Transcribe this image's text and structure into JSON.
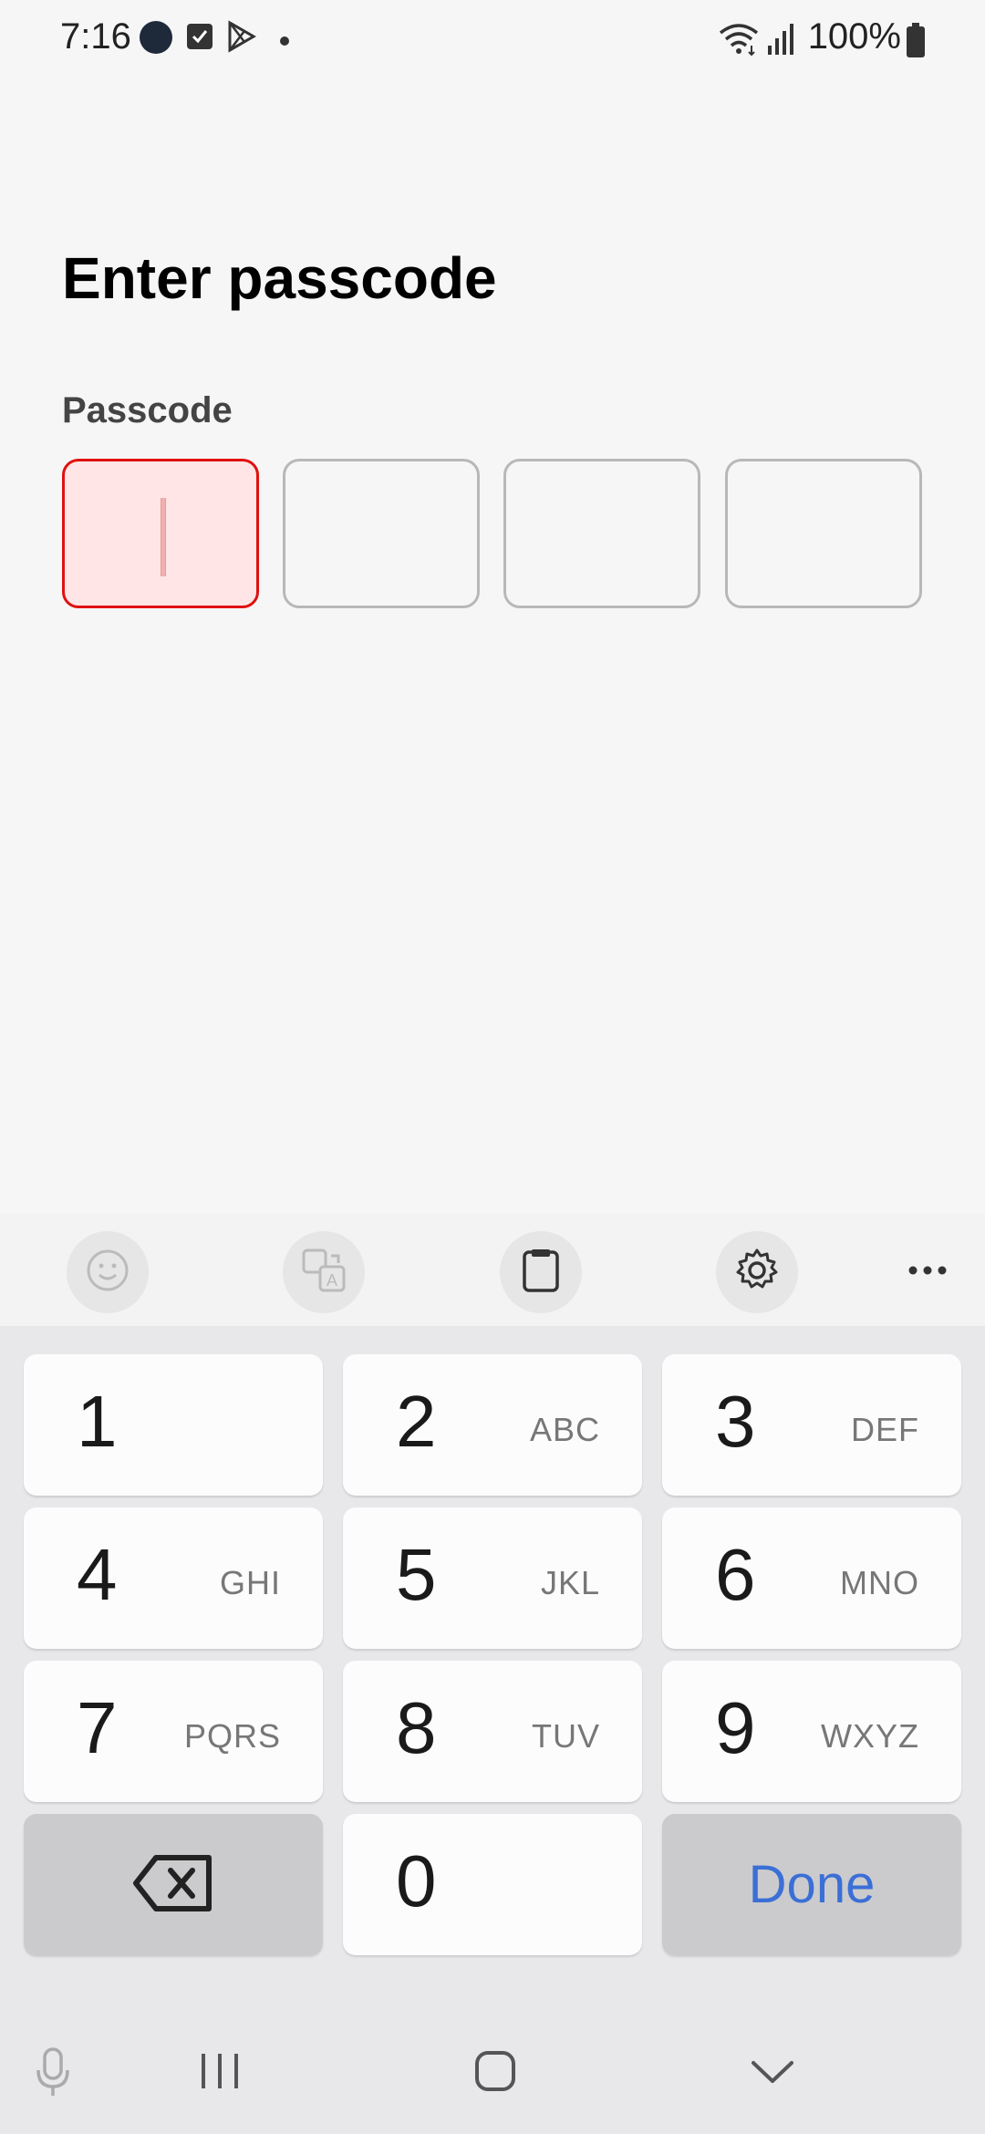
{
  "status_bar": {
    "time": "7:16",
    "battery": "100%"
  },
  "page": {
    "title": "Enter passcode",
    "passcode_label": "Passcode"
  },
  "toolbar": {
    "icons": [
      "emoji-icon",
      "translate-icon",
      "clipboard-icon",
      "settings-icon",
      "more-icon"
    ]
  },
  "keypad": {
    "k1": {
      "digit": "1",
      "letters": ""
    },
    "k2": {
      "digit": "2",
      "letters": "ABC"
    },
    "k3": {
      "digit": "3",
      "letters": "DEF"
    },
    "k4": {
      "digit": "4",
      "letters": "GHI"
    },
    "k5": {
      "digit": "5",
      "letters": "JKL"
    },
    "k6": {
      "digit": "6",
      "letters": "MNO"
    },
    "k7": {
      "digit": "7",
      "letters": "PQRS"
    },
    "k8": {
      "digit": "8",
      "letters": "TUV"
    },
    "k9": {
      "digit": "9",
      "letters": "WXYZ"
    },
    "k0": {
      "digit": "0",
      "letters": ""
    },
    "done_label": "Done"
  },
  "colors": {
    "active_border": "#e01010",
    "active_fill": "#ffe5e5",
    "done_text": "#3b6fd6"
  }
}
